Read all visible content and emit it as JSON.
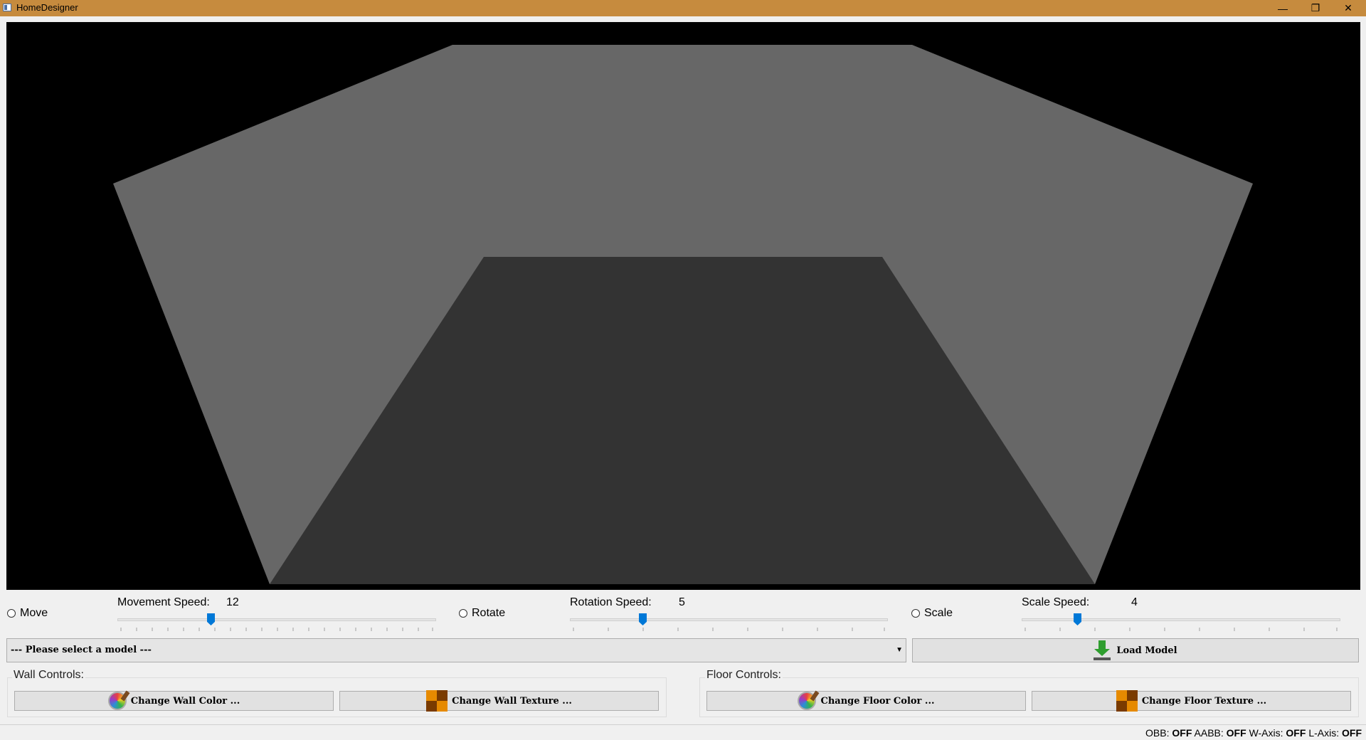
{
  "window": {
    "title": "HomeDesigner",
    "minimize_glyph": "—",
    "restore_glyph": "❐",
    "close_glyph": "✕"
  },
  "viewport": {
    "background": "#000000",
    "wall_color": "#676767",
    "floor_color": "#333333"
  },
  "transform_controls": {
    "move": {
      "label": "Move",
      "selected": false,
      "speed_label": "Movement Speed:",
      "speed_value": "12",
      "slider_value": 12,
      "slider_max": 40
    },
    "rotate": {
      "label": "Rotate",
      "selected": false,
      "speed_label": "Rotation Speed:",
      "speed_value": "5",
      "slider_value": 5,
      "slider_max": 20
    },
    "scale": {
      "label": "Scale",
      "selected": false,
      "speed_label": "Scale Speed:",
      "speed_value": "4",
      "slider_value": 4,
      "slider_max": 20
    }
  },
  "model": {
    "combo_value": "--- Please select a model ---",
    "load_label": "Load Model"
  },
  "wall_controls": {
    "title": "Wall Controls:",
    "color_label": "Change Wall Color ...",
    "texture_label": "Change Wall Texture ..."
  },
  "floor_controls": {
    "title": "Floor Controls:",
    "color_label": "Change Floor Color ...",
    "texture_label": "Change Floor Texture ..."
  },
  "status": {
    "obb_label": "OBB:",
    "obb_value": "OFF",
    "aabb_label": "AABB:",
    "aabb_value": "OFF",
    "waxis_label": "W-Axis:",
    "waxis_value": "OFF",
    "laxis_label": "L-Axis:",
    "laxis_value": "OFF"
  },
  "icons": {
    "app": "app-window-icon",
    "color": "color-palette-icon",
    "texture": "checker-texture-icon",
    "load": "download-arrow-icon"
  }
}
